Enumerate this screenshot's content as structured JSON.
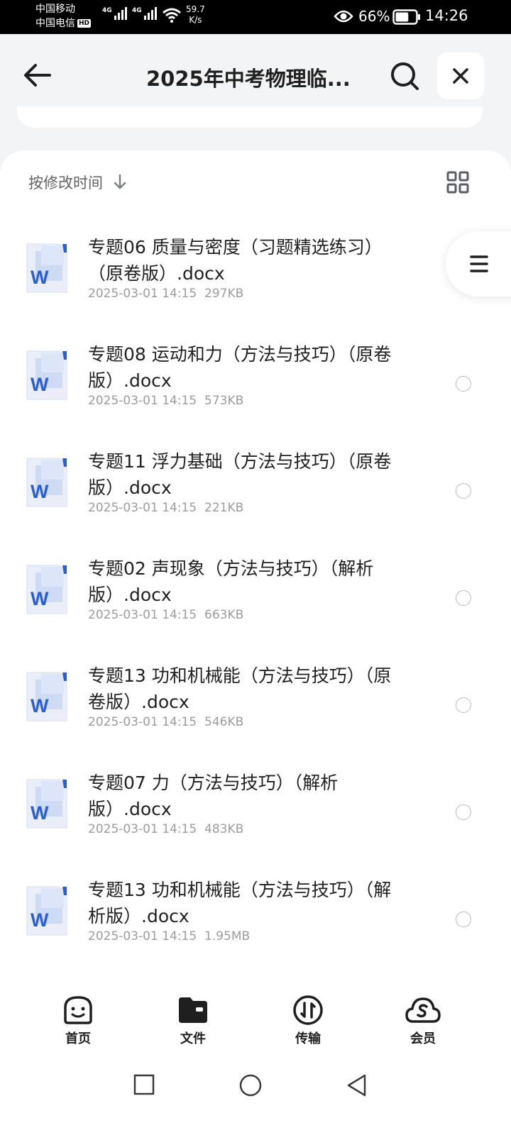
{
  "status_bar": {
    "carrier1": "中国移动",
    "carrier2": "中国电信",
    "hd": "HD",
    "network1": "4G",
    "network2": "4G",
    "speed_value": "59.7",
    "speed_unit": "K/s",
    "battery": "66%",
    "battery_level": 0.66,
    "time": "14:26"
  },
  "header": {
    "title": "2025年中考物理临..."
  },
  "sort": {
    "label": "按修改时间"
  },
  "files": [
    {
      "name": "专题06 质量与密度（习题精选练习）（原卷版）.docx",
      "meta": "2025-03-01 14:15  297KB"
    },
    {
      "name": "专题08 运动和力（方法与技巧）（原卷版）.docx",
      "meta": "2025-03-01 14:15  573KB"
    },
    {
      "name": "专题11 浮力基础（方法与技巧）（原卷版）.docx",
      "meta": "2025-03-01 14:15  221KB"
    },
    {
      "name": "专题02 声现象（方法与技巧）（解析版）.docx",
      "meta": "2025-03-01 14:15  663KB"
    },
    {
      "name": "专题13 功和机械能（方法与技巧）（原卷版）.docx",
      "meta": "2025-03-01 14:15  546KB"
    },
    {
      "name": "专题07 力（方法与技巧）（解析版）.docx",
      "meta": "2025-03-01 14:15  483KB"
    },
    {
      "name": "专题13 功和机械能（方法与技巧）（解析版）.docx",
      "meta": "2025-03-01 14:15  1.95MB"
    }
  ],
  "nav": {
    "home": "首页",
    "files": "文件",
    "transfer": "传输",
    "member": "会员"
  },
  "colors": {
    "word_blue": "#2b5fd0",
    "page_bg": "#f3f4f6"
  }
}
